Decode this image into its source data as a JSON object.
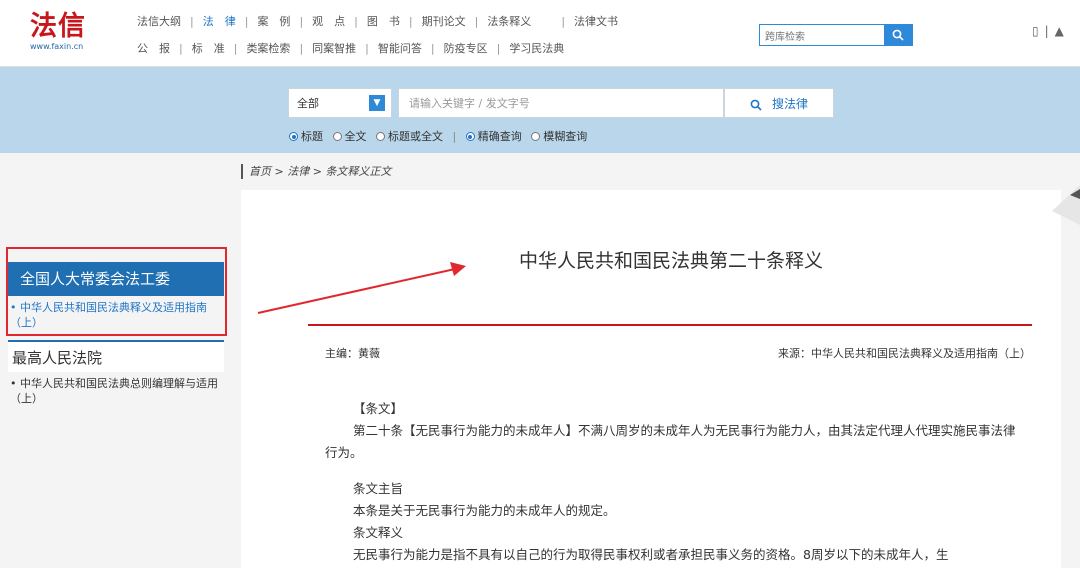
{
  "logo": {
    "name": "法信",
    "url": "www.faxin.cn"
  },
  "nav": {
    "row1": [
      "法信大纲",
      "法　律",
      "案　例",
      "观　点",
      "图　书",
      "期刊论文",
      "法条释义",
      "法律文书"
    ],
    "row2": [
      "公　报",
      "标　准",
      "类案检索",
      "同案智推",
      "智能问答",
      "防疫专区",
      "学习民法典"
    ],
    "active": "法　律"
  },
  "mini_search": {
    "placeholder": "跨库检索"
  },
  "search": {
    "scope": "全部",
    "placeholder": "请输入关键字 / 发文字号",
    "button": "搜法律",
    "options": [
      "标题",
      "全文",
      "标题或全文",
      "精确查询",
      "模糊查询"
    ]
  },
  "breadcrumb": {
    "home": "首页",
    "sep": " > ",
    "level1": "法律",
    "level2": "条文释义正文"
  },
  "sidebar": {
    "section1_title": "全国人大常委会法工委",
    "section1_link": "• 中华人民共和国民法典释义及适用指南（上）",
    "section2_title": "最高人民法院",
    "section2_link": "• 中华人民共和国民法典总则编理解与适用（上）"
  },
  "doc": {
    "title": "中华人民共和国民法典第二十条释义",
    "editor": "主编：黄薇",
    "source": "来源：中华人民共和国民法典释义及适用指南（上）",
    "p1": "【条文】",
    "p2": "第二十条【无民事行为能力的未成年人】不满八周岁的未成年人为无民事行为能力人，由其法定代理人代理实施民事法律行为。",
    "p3": "条文主旨",
    "p4": "本条是关于无民事行为能力的未成年人的规定。",
    "p5": "条文释义",
    "p6": "无民事行为能力是指不具有以自己的行为取得民事权利或者承担民事义务的资格。8周岁以下的未成年人，生"
  },
  "colors": {
    "brand_red": "#c8161d",
    "link_blue": "#1f74c7",
    "band_blue": "#b9d6ea",
    "highlight_red": "#e0282e"
  }
}
